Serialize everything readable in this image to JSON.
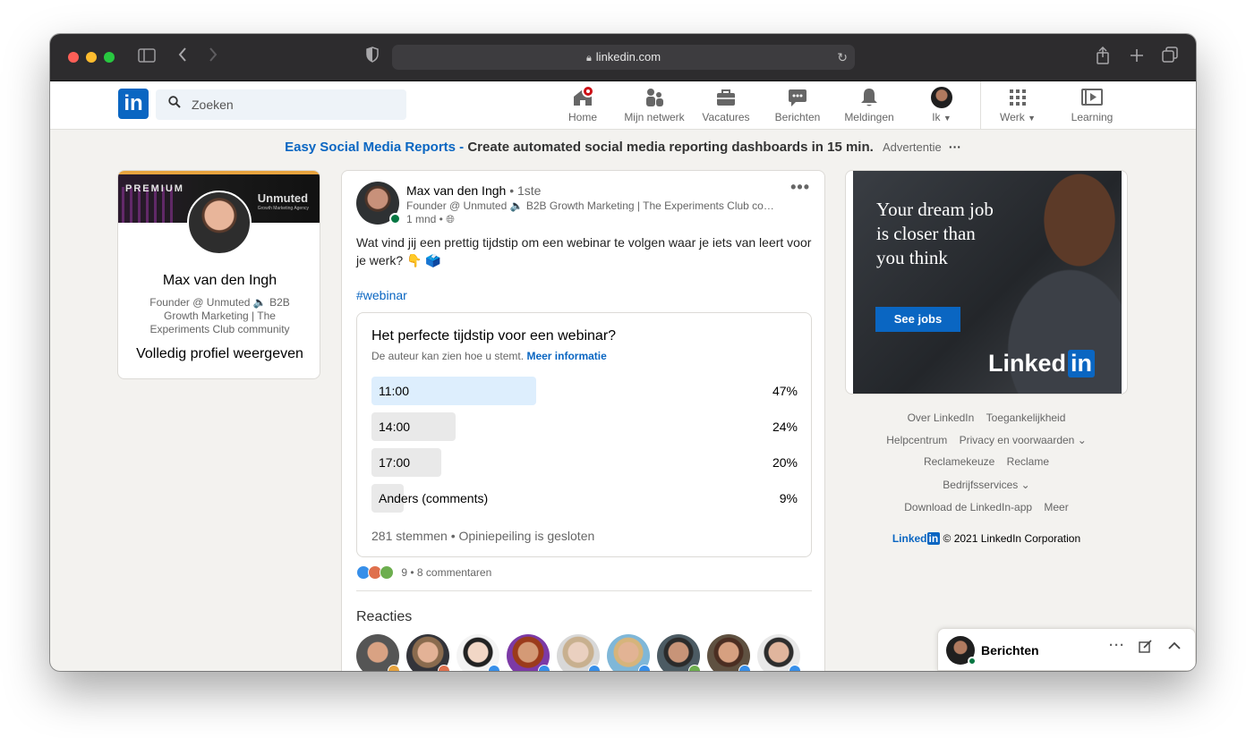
{
  "browser": {
    "url": "linkedin.com"
  },
  "nav": {
    "logo": "in",
    "search_placeholder": "Zoeken",
    "items": [
      {
        "label": "Home"
      },
      {
        "label": "Mijn netwerk"
      },
      {
        "label": "Vacatures"
      },
      {
        "label": "Berichten"
      },
      {
        "label": "Meldingen"
      },
      {
        "label": "Ik"
      },
      {
        "label": "Werk"
      },
      {
        "label": "Learning"
      }
    ]
  },
  "ad_line": {
    "link": "Easy Social Media Reports -",
    "text": "Create automated social media reporting dashboards in 15 min.",
    "tag": "Advertentie",
    "more": "···"
  },
  "profile": {
    "premium": "PREMIUM",
    "brand": "Unmuted",
    "brand_sub": "Growth Marketing Agency",
    "name": "Max van den Ingh",
    "headline": "Founder @ Unmuted 🔈 B2B Growth Marketing | The Experiments Club community",
    "view_profile": "Volledig profiel weergeven"
  },
  "post": {
    "author": "Max van den Ingh",
    "degree": "• 1ste",
    "subline": "Founder @ Unmuted 🔈 B2B Growth Marketing | The Experiments Club community",
    "time": "1 mnd •",
    "more": "•••",
    "body": "Wat vind jij een prettig tijdstip om een webinar te volgen waar je iets van leert voor je werk? 👇 🗳️",
    "hashtag": "#webinar",
    "poll": {
      "question": "Het perfecte tijdstip voor een webinar?",
      "note": "De auteur kan zien hoe u stemt.",
      "note_link": "Meer informatie",
      "options": [
        {
          "label": "11:00",
          "pct": "47%",
          "value": 47
        },
        {
          "label": "14:00",
          "pct": "24%",
          "value": 24
        },
        {
          "label": "17:00",
          "pct": "20%",
          "value": 20
        },
        {
          "label": "Anders (comments)",
          "pct": "9%",
          "value": 9
        }
      ],
      "footer": "281 stemmen • Opiniepeiling is gesloten"
    },
    "social": {
      "reaction_count": "9",
      "comments": "8 commentaren"
    },
    "reactions_title": "Reacties"
  },
  "ad_card": {
    "headline": "Your dream job is closer than you think",
    "cta": "See jobs",
    "brand_a": "Linked",
    "brand_b": "in"
  },
  "footer": {
    "links_row1": [
      "Over LinkedIn",
      "Toegankelijkheid"
    ],
    "links_row2": [
      "Helpcentrum",
      "Privacy en voorwaarden ⌄"
    ],
    "links_row3": [
      "Reclamekeuze",
      "Reclame"
    ],
    "links_row4": [
      "Bedrijfsservices ⌄"
    ],
    "links_row5": [
      "Download de LinkedIn-app",
      "Meer"
    ],
    "copy_brand": "Linked",
    "copy_brand_in": "in",
    "copyright": "© 2021 LinkedIn Corporation"
  },
  "messaging": {
    "title": "Berichten"
  },
  "colors": {
    "brand": "#0a66c2",
    "page_bg": "#f3f2ef",
    "premium_gold": "#e7a33e",
    "poll_lead": "#ddeefd",
    "notification_red": "#cc1016"
  }
}
